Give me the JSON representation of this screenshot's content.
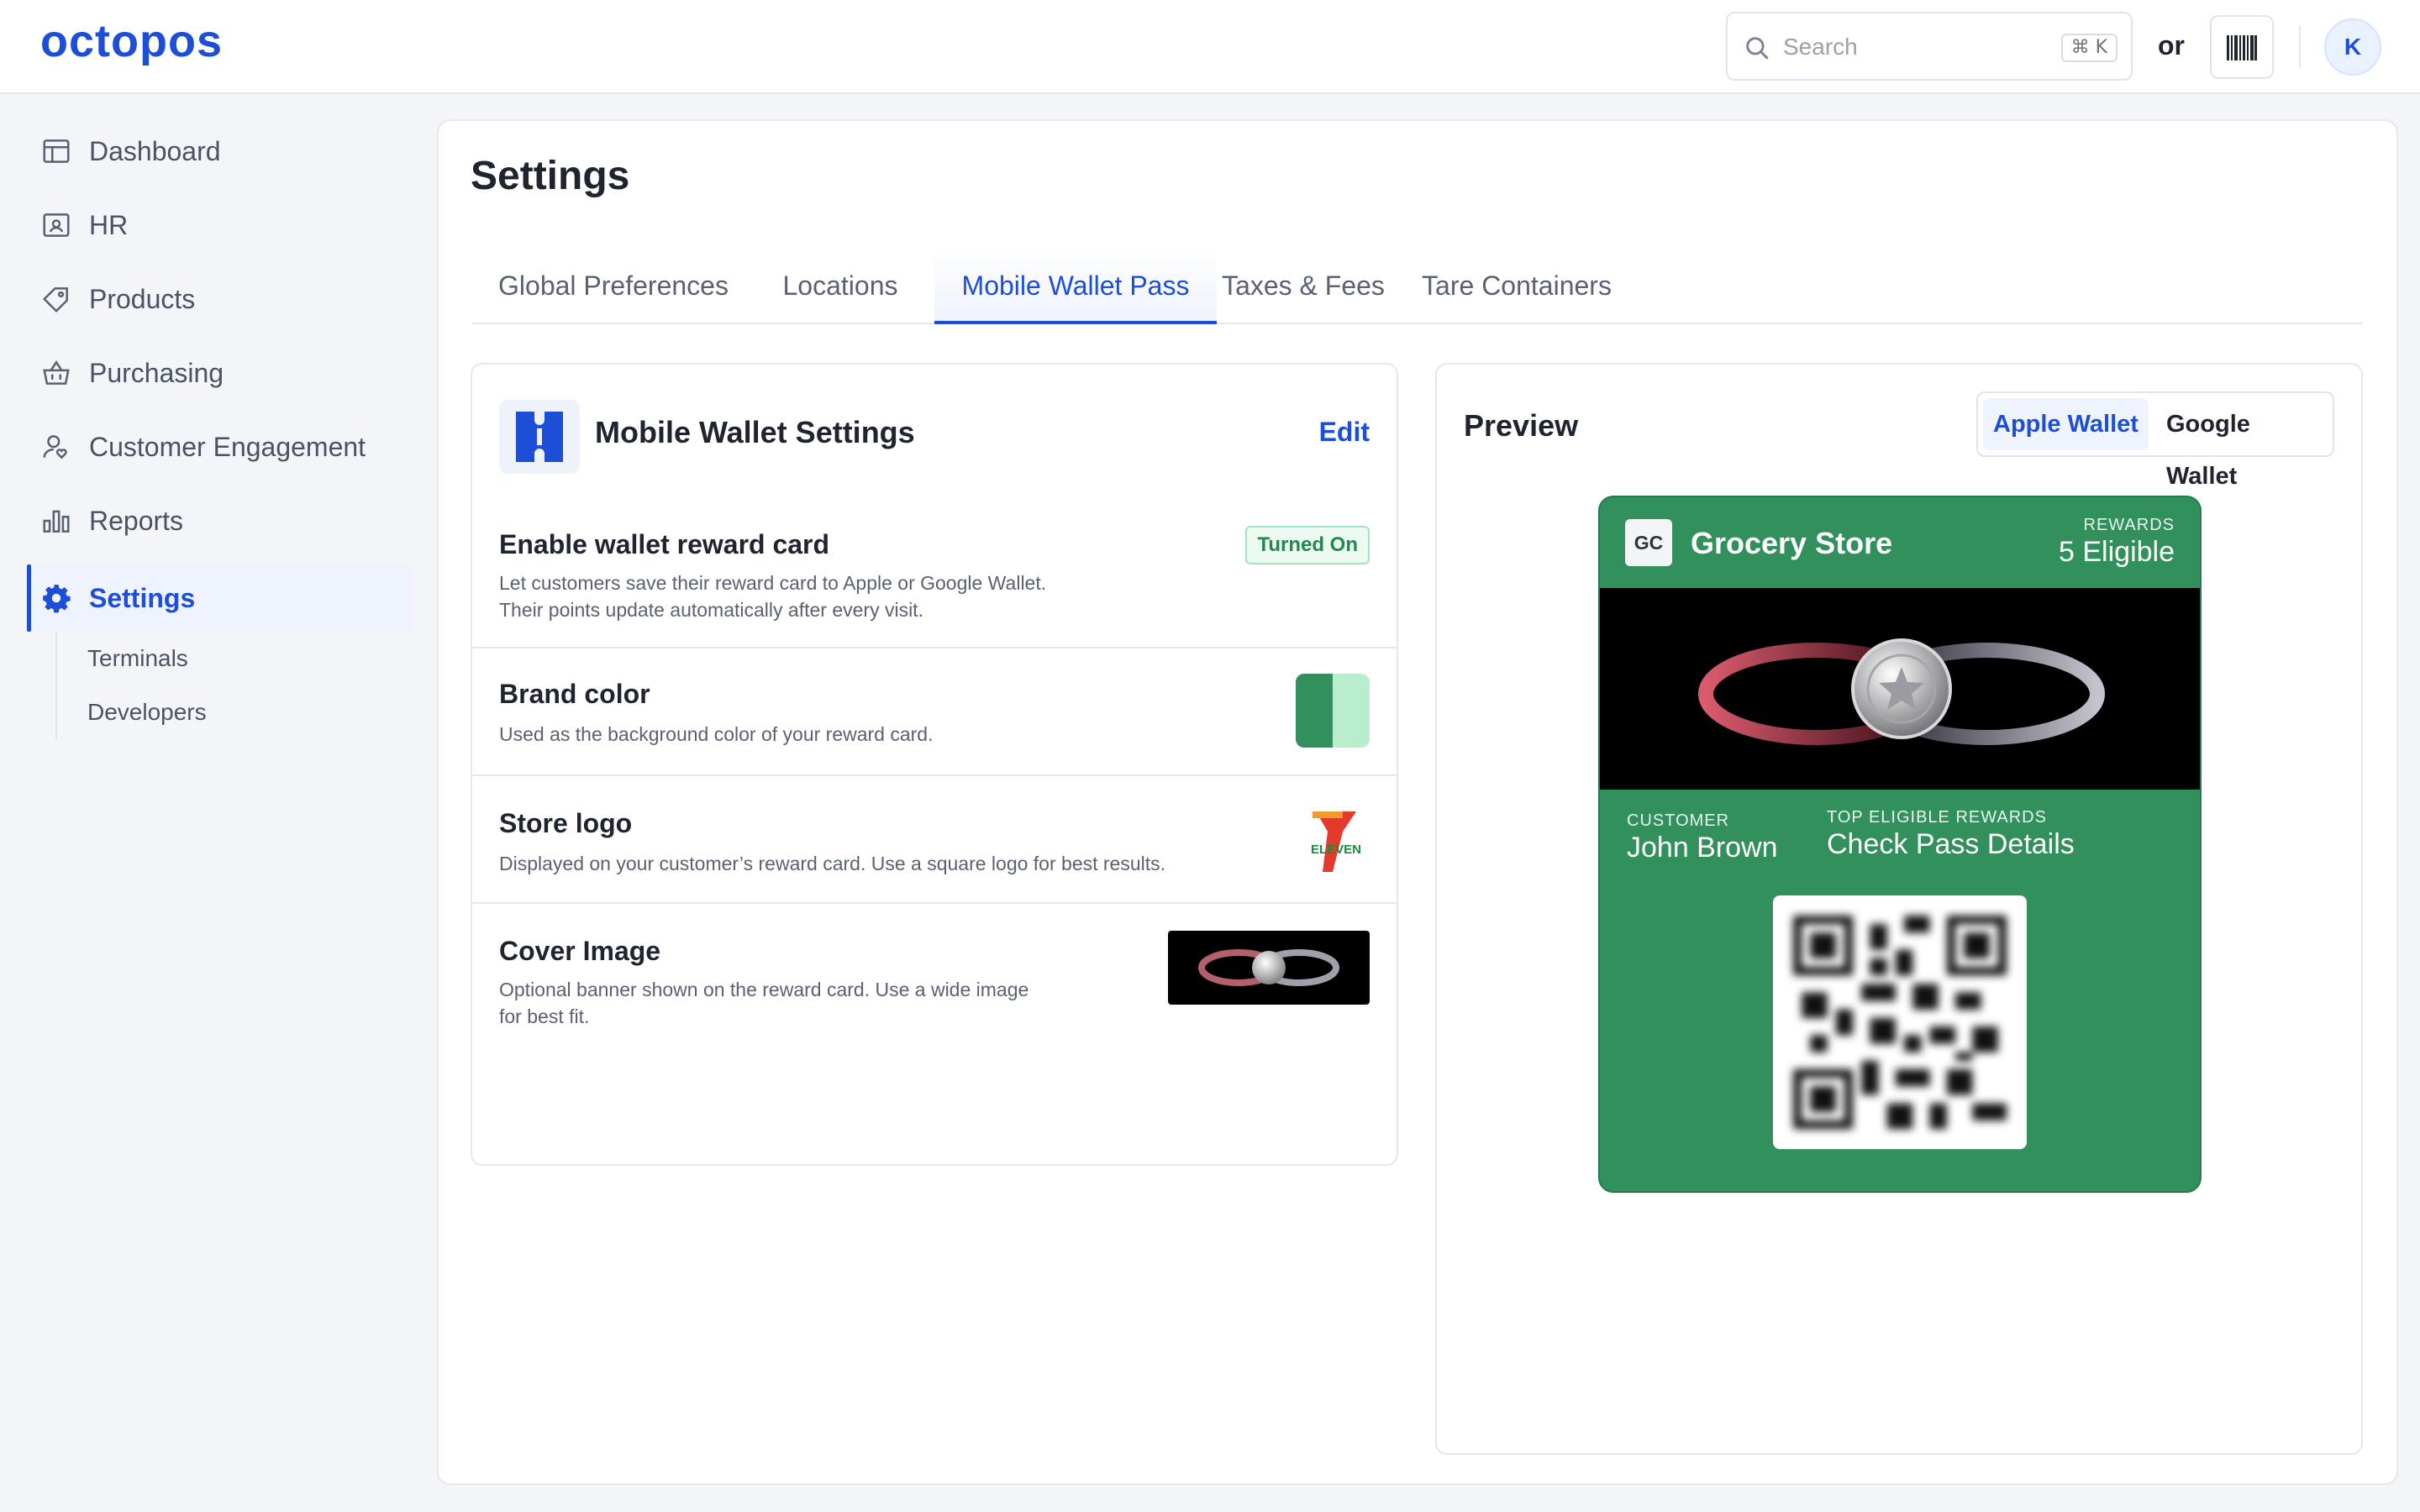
{
  "app": {
    "logo_text": "octopos"
  },
  "topbar": {
    "search_placeholder": "Search",
    "search_shortcut": "⌘ K",
    "or_text": "or",
    "avatar_initial": "K"
  },
  "sidebar": {
    "items": [
      {
        "label": "Dashboard",
        "icon": "dashboard-icon"
      },
      {
        "label": "HR",
        "icon": "id-card-icon"
      },
      {
        "label": "Products",
        "icon": "tag-icon"
      },
      {
        "label": "Purchasing",
        "icon": "basket-icon"
      },
      {
        "label": "Customer Engagement",
        "icon": "user-heart-icon"
      },
      {
        "label": "Reports",
        "icon": "bar-chart-icon"
      },
      {
        "label": "Settings",
        "icon": "gear-icon",
        "active": true
      }
    ],
    "sub_items": [
      {
        "label": "Terminals"
      },
      {
        "label": "Developers"
      }
    ]
  },
  "page": {
    "title": "Settings",
    "tabs": [
      {
        "label": "Global Preferences"
      },
      {
        "label": "Locations"
      },
      {
        "label": "Mobile Wallet Pass",
        "active": true
      },
      {
        "label": "Taxes & Fees"
      },
      {
        "label": "Tare Containers"
      }
    ]
  },
  "wallet_settings": {
    "title": "Mobile Wallet Settings",
    "edit_label": "Edit",
    "rows": [
      {
        "title": "Enable wallet reward card",
        "desc_line1": "Let customers save their reward card to Apple or Google Wallet.",
        "desc_line2": "Their points update automatically after every visit.",
        "status": "Turned On"
      },
      {
        "title": "Brand color",
        "desc_line1": "Used as the background color of your reward card."
      },
      {
        "title": "Store logo",
        "desc_line1": "Displayed on your customer’s reward card. Use a square logo for best results.",
        "logo_text": "ELEVEN"
      },
      {
        "title": "Cover Image",
        "desc_line1": "Optional banner shown on the reward card. Use a wide image",
        "desc_line2": "for best fit."
      }
    ]
  },
  "preview": {
    "title": "Preview",
    "options": [
      {
        "label": "Apple Wallet",
        "active": true
      },
      {
        "label": "Google Wallet"
      }
    ],
    "pass": {
      "badge": "GC",
      "store_name": "Grocery Store",
      "rewards_label": "REWARDS",
      "rewards_value": "5 Eligible",
      "customer_label": "CUSTOMER",
      "customer_value": "John Brown",
      "top_rewards_label": "TOP ELIGIBLE REWARDS",
      "top_rewards_value": "Check Pass Details"
    }
  },
  "colors": {
    "accent": "#1d4ed8",
    "brand_dark": "#31905c",
    "brand_light": "#b8edcd",
    "status_on": "#1f8a4d"
  }
}
